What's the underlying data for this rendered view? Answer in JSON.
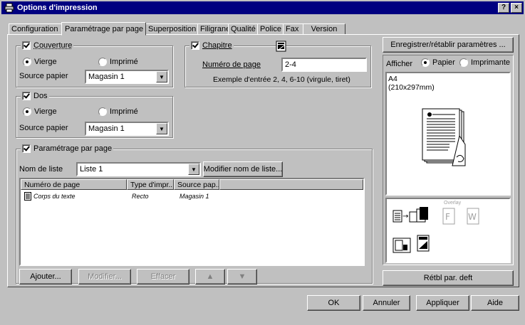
{
  "window": {
    "title": "Options d'impression",
    "help_btn": "?",
    "close_btn": "×"
  },
  "tabs": [
    {
      "label": "Configuration"
    },
    {
      "label": "Paramétrage par page"
    },
    {
      "label": "Superposition"
    },
    {
      "label": "Filigrane"
    },
    {
      "label": "Qualité"
    },
    {
      "label": "Police"
    },
    {
      "label": "Fax"
    },
    {
      "label": "Version"
    }
  ],
  "couverture": {
    "label": "Couverture",
    "vierge": "Vierge",
    "imprime": "Imprimé",
    "source_label": "Source papier",
    "source_value": "Magasin 1"
  },
  "chapitre": {
    "label": "Chapitre",
    "numero_label": "Numéro de page",
    "numero_value": "2-4",
    "example": "Exemple d'entrée 2, 4, 6-10 (virgule, tiret)"
  },
  "dos": {
    "label": "Dos",
    "vierge": "Vierge",
    "imprime": "Imprimé",
    "source_label": "Source papier",
    "source_value": "Magasin 1"
  },
  "parametrage": {
    "label": "Paramétrage par page",
    "nom_label": "Nom de liste",
    "nom_value": "Liste 1",
    "modifier_nom": "Modifier nom de liste...",
    "columns": [
      "Numéro de page",
      "Type d'impr...",
      "Source pap..."
    ],
    "rows": [
      {
        "page": "Corps du texte",
        "type": "Recto",
        "source": "Magasin 1"
      }
    ],
    "ajouter": "Ajouter...",
    "modifier": "Modifier...",
    "effacer": "Effacer"
  },
  "right": {
    "save_btn": "Enregistrer/rétablir paramètres ...",
    "afficher": "Afficher",
    "papier": "Papier",
    "imprimante": "Imprimante",
    "paper_size": "A4",
    "paper_dims": "(210x297mm)",
    "overlay_label": "Overlay",
    "reset_btn": "Rétbl par. deft"
  },
  "footer": {
    "ok": "OK",
    "annuler": "Annuler",
    "appliquer": "Appliquer",
    "aide": "Aide"
  }
}
